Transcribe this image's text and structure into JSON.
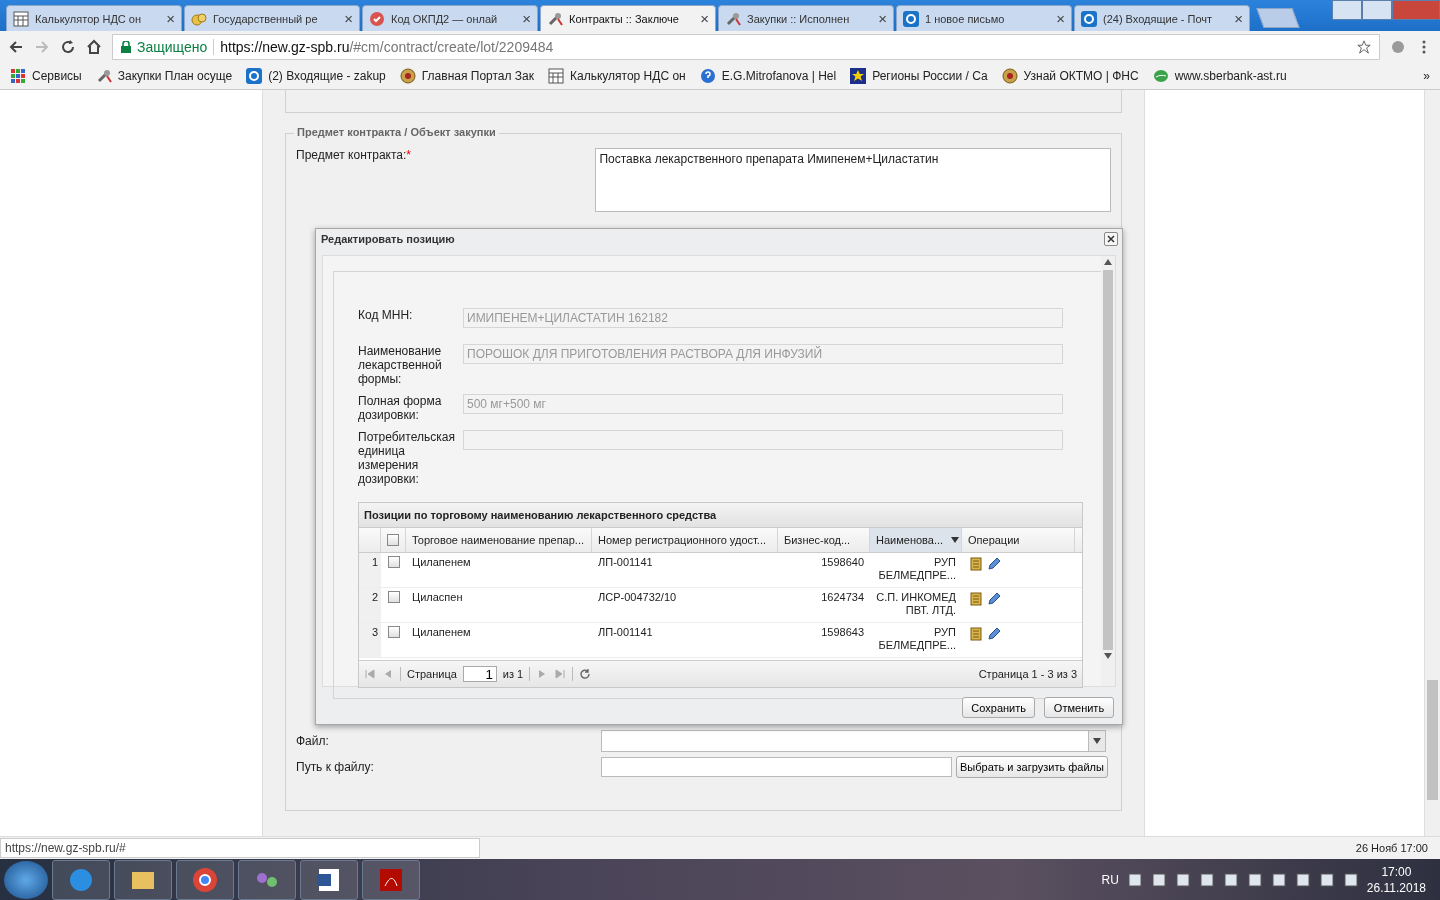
{
  "browser": {
    "tabs": [
      {
        "title": "Калькулятор НДС он",
        "kind": "grid",
        "selected": false
      },
      {
        "title": "Государственный ре",
        "kind": "coins",
        "selected": false
      },
      {
        "title": "Код ОКПД2 — онлай",
        "kind": "badge",
        "selected": false
      },
      {
        "title": "Контракты :: Заключе",
        "kind": "tool",
        "selected": true
      },
      {
        "title": "Закупки :: Исполнен",
        "kind": "tool",
        "selected": false
      },
      {
        "title": "1 новое письмо",
        "kind": "mail",
        "selected": false
      },
      {
        "title": "(24) Входящие - Почт",
        "kind": "mail",
        "selected": false
      }
    ],
    "close_glyph": "×",
    "secure_label": "Защищено",
    "url_host": "https://new.gz-spb.ru",
    "url_path": "/#cm/contract/create/lot/2209484",
    "bookmarks": [
      {
        "label": "Сервисы",
        "kind": "apps"
      },
      {
        "label": "Закупки План осуще",
        "kind": "tool"
      },
      {
        "label": "(2) Входящие - zakup",
        "kind": "mail"
      },
      {
        "label": "Главная Портал Зак",
        "kind": "emblem"
      },
      {
        "label": "Калькулятор НДС он",
        "kind": "grid"
      },
      {
        "label": "E.G.Mitrofanova | Hel",
        "kind": "help"
      },
      {
        "label": "Регионы России / Ca",
        "kind": "star"
      },
      {
        "label": "Узнай ОКТМО | ФНС",
        "kind": "emblem"
      },
      {
        "label": "www.sberbank-ast.ru",
        "kind": "leaf"
      }
    ],
    "bookmarks_more": "»"
  },
  "form": {
    "section_legend": "Предмет контракта / Объект закупки",
    "subject_label": "Предмет контракта:",
    "required_mark": "*",
    "subject_value": "Поставка лекарственного препарата Имипенем+Циластатин",
    "file_label": "Файл:",
    "file_path_label": "Путь к файлу:",
    "upload_button": "Выбрать и загрузить файлы"
  },
  "dialog": {
    "title": "Редактировать позицию",
    "fields": [
      {
        "label": "Код МНН:",
        "value": "ИМИПЕНЕМ+ЦИЛАСТАТИН 162182"
      },
      {
        "label": "Наименование лекарственной формы:",
        "value": "ПОРОШОК ДЛЯ ПРИГОТОВЛЕНИЯ РАСТВОРА ДЛЯ ИНФУЗИЙ"
      },
      {
        "label": "Полная форма дозировки:",
        "value": "500 мг+500 мг"
      },
      {
        "label": "Потребительская единица измерения дозировки:"
      }
    ],
    "grid": {
      "title": "Позиции по торговому наименованию лекарственного средства",
      "all_checked": false,
      "columns": [
        {
          "label": "Торговое наименование препар...",
          "active": false
        },
        {
          "label": "Номер регистрационного удост...",
          "active": false
        },
        {
          "label": "Бизнес-код...",
          "active": false
        },
        {
          "label": "Наименова...",
          "active": true
        },
        {
          "label": "Операции",
          "active": false
        }
      ],
      "rows": [
        {
          "number": "1",
          "checked": false,
          "name": "Цилапенем",
          "registration": "ЛП-001141",
          "code": "1598640",
          "org": "РУП БЕЛМЕДПРЕ..."
        },
        {
          "number": "2",
          "checked": false,
          "name": "Циласпен",
          "registration": "ЛСР-004732/10",
          "code": "1624734",
          "org": "С.П. ИНКОМЕД ПВТ. ЛТД."
        },
        {
          "number": "3",
          "checked": false,
          "name": "Цилапенем",
          "registration": "ЛП-001141",
          "code": "1598643",
          "org": "РУП БЕЛМЕДПРЕ..."
        }
      ],
      "pager": {
        "page_label": "Страница",
        "page_value": "1",
        "of_label": "из 1",
        "summary": "Страница 1 - 3 из 3"
      }
    },
    "buttons": [
      "Сохранить",
      "Отменить"
    ]
  },
  "status_url": "https://new.gz-spb.ru/#",
  "page_clock": "26 Нояб 17:00",
  "taskbar": {
    "language": "RU",
    "time": "17:00",
    "date": "26.11.2018"
  }
}
